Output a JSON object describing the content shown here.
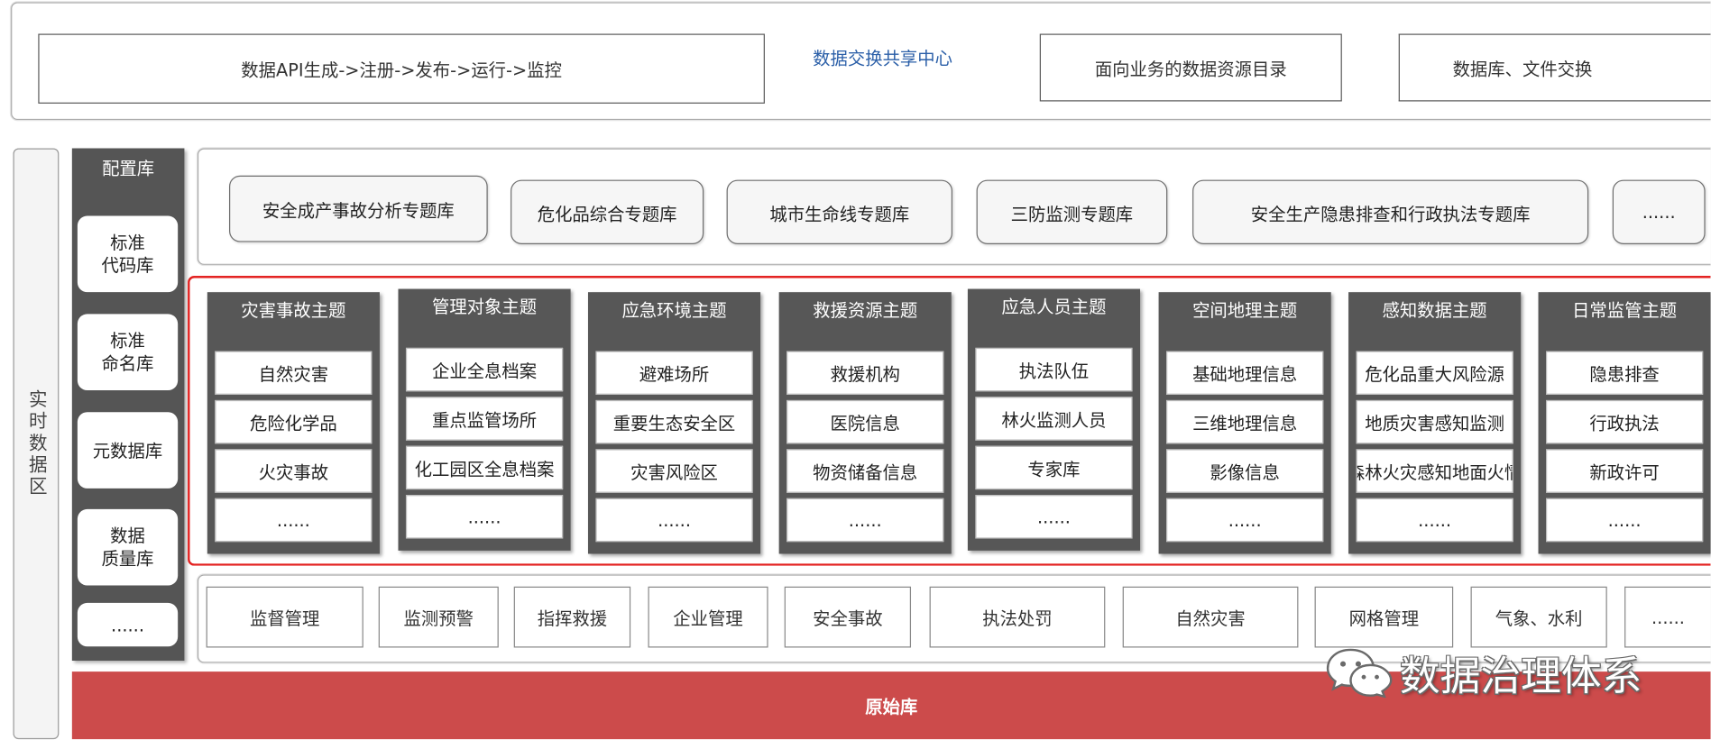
{
  "exchange": {
    "pipeline_label": "数据API生成->注册->发布->运行->监控",
    "title": "数据交换共享中心",
    "catalog_label": "面向业务的数据资源目录",
    "file_exchange_label": "数据库、文件交换"
  },
  "realtime_zone": {
    "label": "实时数据区"
  },
  "config_library": {
    "title": "配置库",
    "items": [
      "标准\n代码库",
      "标准\n命名库",
      "元数据库",
      "数据\n质量库",
      "......"
    ]
  },
  "topic_libraries": {
    "items": [
      "安全成产事故分析专题库",
      "危化品综合专题库",
      "城市生命线专题库",
      "三防监测专题库",
      "安全生产隐患排查和行政执法专题库",
      "......"
    ]
  },
  "themes": [
    {
      "title": "灾害事故主题",
      "items": [
        "自然灾害",
        "危险化学品",
        "火灾事故",
        "......"
      ]
    },
    {
      "title": "管理对象主题",
      "items": [
        "企业全息档案",
        "重点监管场所",
        "化工园区全息档案",
        "......"
      ]
    },
    {
      "title": "应急环境主题",
      "items": [
        "避难场所",
        "重要生态安全区",
        "灾害风险区",
        "......"
      ]
    },
    {
      "title": "救援资源主题",
      "items": [
        "救援机构",
        "医院信息",
        "物资储备信息",
        "......"
      ]
    },
    {
      "title": "应急人员主题",
      "items": [
        "执法队伍",
        "林火监测人员",
        "专家库",
        "......"
      ]
    },
    {
      "title": "空间地理主题",
      "items": [
        "基础地理信息",
        "三维地理信息",
        "影像信息",
        "......"
      ]
    },
    {
      "title": "感知数据主题",
      "items": [
        "危化品重大风险源",
        "地质灾害感知监测",
        "森林火灾感知地面火情",
        "......"
      ]
    },
    {
      "title": "日常监管主题",
      "items": [
        "隐患排查",
        "行政执法",
        "新政许可",
        "......"
      ]
    }
  ],
  "business_areas": {
    "items": [
      "监督管理",
      "监测预警",
      "指挥救援",
      "企业管理",
      "安全事故",
      "执法处罚",
      "自然灾害",
      "网格管理",
      "气象、水利",
      "......"
    ]
  },
  "raw_library": {
    "label": "原始库"
  },
  "watermark": {
    "text": "数据治理体系",
    "icon": "wechat-icon"
  },
  "colors": {
    "exchange_title": "#2b5fa8",
    "dark_panel": "#575757",
    "highlight_border": "#e3201f",
    "raw_library": "#cc4b4b"
  }
}
